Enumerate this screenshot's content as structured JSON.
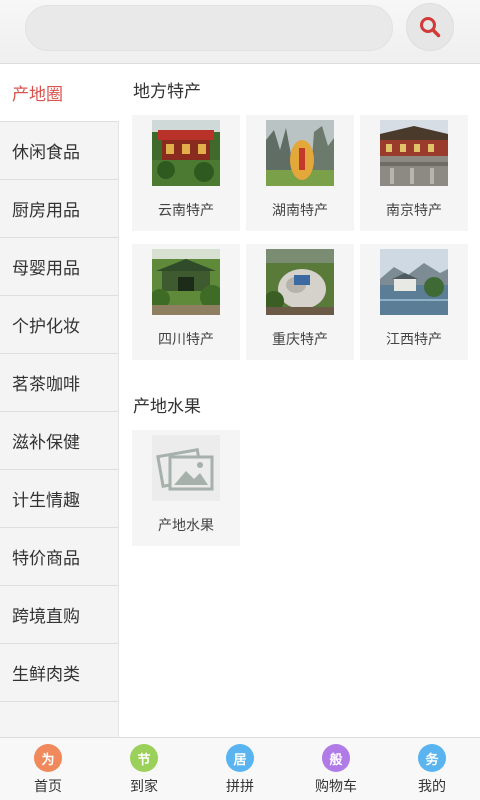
{
  "search": {
    "placeholder": "",
    "value": ""
  },
  "sidebar": {
    "items": [
      {
        "label": "产地圈",
        "active": true
      },
      {
        "label": "休闲食品"
      },
      {
        "label": "厨房用品"
      },
      {
        "label": "母婴用品"
      },
      {
        "label": "个护化妆"
      },
      {
        "label": "茗茶咖啡"
      },
      {
        "label": "滋补保健"
      },
      {
        "label": "计生情趣"
      },
      {
        "label": "特价商品"
      },
      {
        "label": "跨境直购"
      },
      {
        "label": "生鲜肉类"
      }
    ]
  },
  "main": {
    "sections": [
      {
        "title": "地方特产",
        "items": [
          {
            "label": "云南特产",
            "icon": "yunnan-photo"
          },
          {
            "label": "湖南特产",
            "icon": "hunan-photo"
          },
          {
            "label": "南京特产",
            "icon": "nanjing-photo"
          },
          {
            "label": "四川特产",
            "icon": "sichuan-photo"
          },
          {
            "label": "重庆特产",
            "icon": "chongqing-photo"
          },
          {
            "label": "江西特产",
            "icon": "jiangxi-photo"
          }
        ]
      },
      {
        "title": "产地水果",
        "items": [
          {
            "label": "产地水果",
            "icon": "image-placeholder-icon"
          }
        ]
      }
    ]
  },
  "bottom_nav": {
    "items": [
      {
        "label": "首页",
        "icon_text": "为",
        "color": "#f08a5d"
      },
      {
        "label": "到家",
        "icon_text": "节",
        "color": "#9bd15a"
      },
      {
        "label": "拼拼",
        "icon_text": "居",
        "color": "#5ab4f0"
      },
      {
        "label": "购物车",
        "icon_text": "般",
        "color": "#b07be6"
      },
      {
        "label": "我的",
        "icon_text": "务",
        "color": "#5ab4f0"
      }
    ]
  },
  "colors": {
    "accent": "#d9534f",
    "search_icon": "#d23a3a"
  }
}
